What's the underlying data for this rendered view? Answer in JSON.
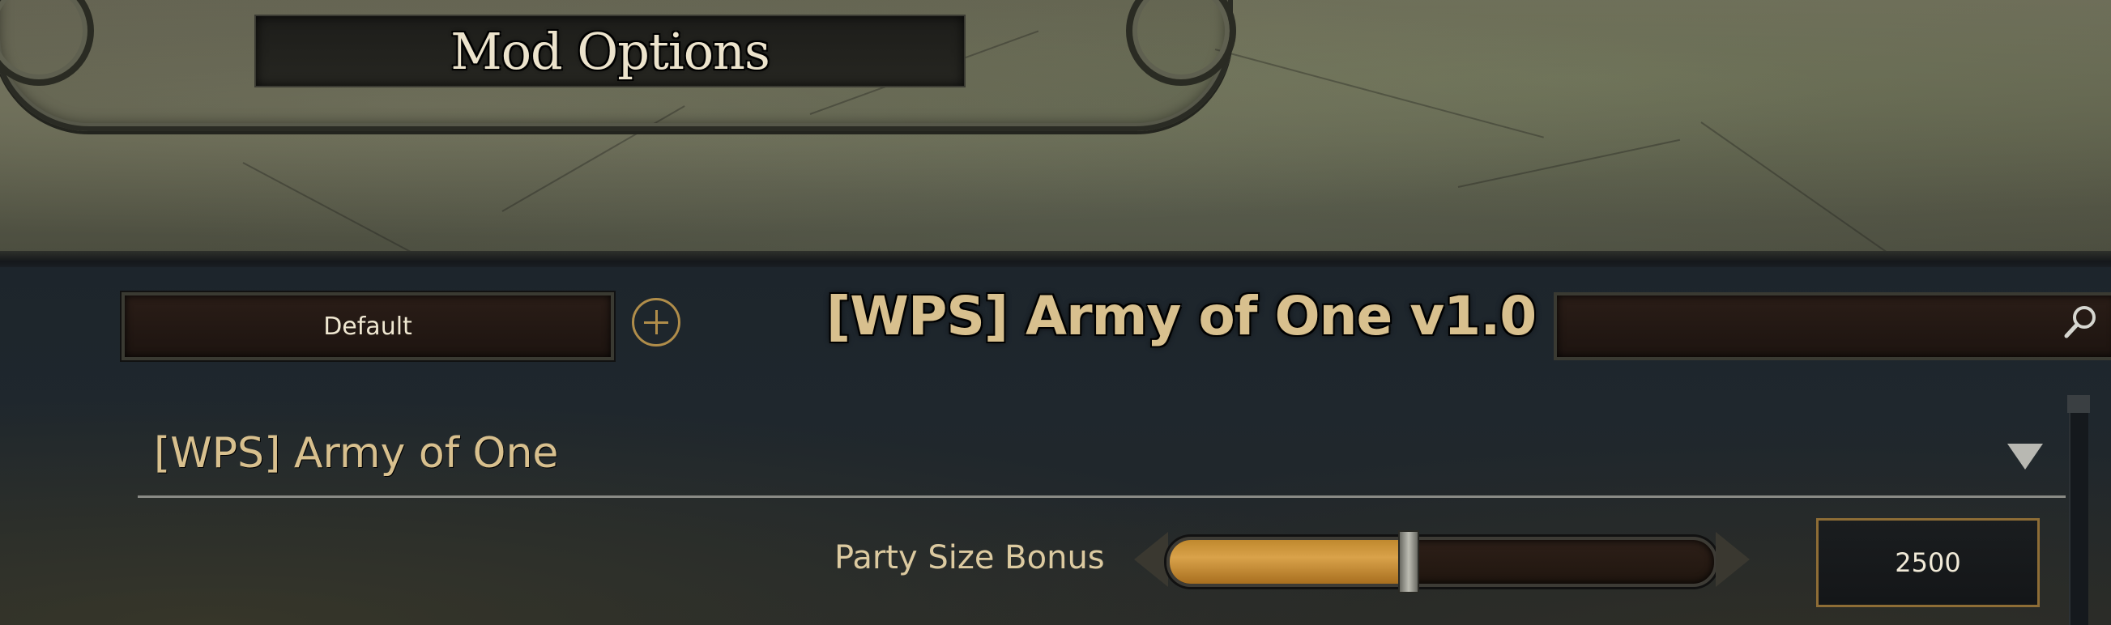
{
  "header": {
    "title": "Mod Options"
  },
  "toolbar": {
    "preset_label": "Default",
    "mod_title": "[WPS] Army of One v1.0",
    "search_value": ""
  },
  "groups": [
    {
      "title": "[WPS] Army of One",
      "settings": [
        {
          "label": "Party Size Bonus",
          "value": "2500",
          "slider_fraction": 0.44
        }
      ]
    }
  ],
  "colors": {
    "accent": "#d8c08e",
    "slider_fill": "#c0892e",
    "panel": "#1d252c"
  },
  "icons": {
    "add": "plus-circle-icon",
    "search": "magnifier-icon",
    "collapse": "triangle-down-icon"
  }
}
